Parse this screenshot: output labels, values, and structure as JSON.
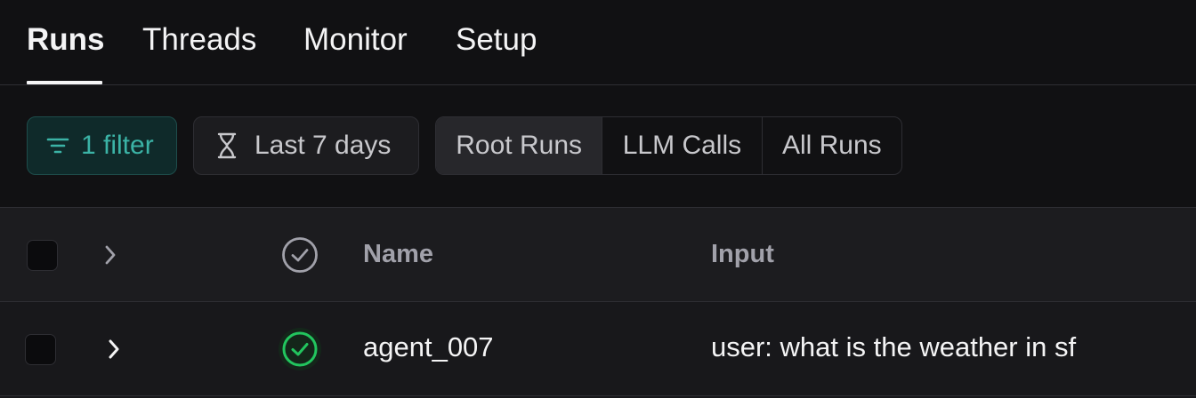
{
  "tabs": [
    {
      "label": "Runs",
      "active": true
    },
    {
      "label": "Threads",
      "active": false
    },
    {
      "label": "Monitor",
      "active": false
    },
    {
      "label": "Setup",
      "active": false
    }
  ],
  "toolbar": {
    "filter_label": "1 filter",
    "filter_icon": "filter-lines-icon",
    "date_label": "Last 7 days",
    "date_icon": "hourglass-icon",
    "run_types": [
      "Root Runs",
      "LLM Calls",
      "All Runs"
    ],
    "selected_run_type": "Root Runs"
  },
  "table": {
    "columns": {
      "status_icon": "check-circle-icon",
      "name": "Name",
      "input": "Input"
    },
    "rows": [
      {
        "status": "success",
        "name": "agent_007",
        "input": "user: what is the weather in sf"
      }
    ]
  },
  "colors": {
    "accent_teal": "#3bb3a6",
    "success_green": "#22c55e",
    "background": "#18181b"
  }
}
